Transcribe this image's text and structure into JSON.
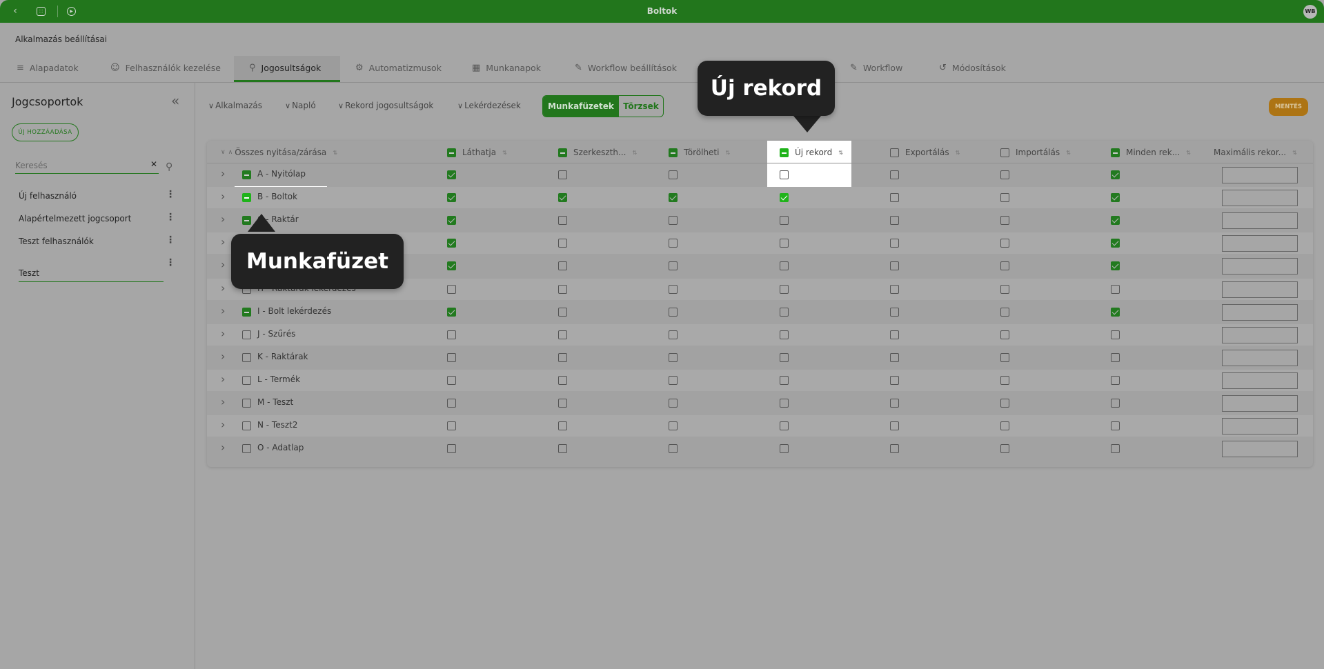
{
  "topbar": {
    "title": "Boltok",
    "avatar": "WB",
    "icons": [
      "back-icon",
      "grid-icon",
      "play-icon"
    ]
  },
  "app_title": "Alkalmazás beállításai",
  "tabs": [
    {
      "label": "Alapadatok",
      "icon": "database-icon"
    },
    {
      "label": "Felhasználók kezelése",
      "icon": "user-icon"
    },
    {
      "label": "Jogosultságok",
      "icon": "key-icon",
      "active": true
    },
    {
      "label": "Automatizmusok",
      "icon": "gear-cycle-icon"
    },
    {
      "label": "Munkanapok",
      "icon": "calendar-icon"
    },
    {
      "label": "Workflow beállítások",
      "icon": "pencil-icon"
    },
    {
      "label": "Workflow",
      "icon": "pencil-icon"
    },
    {
      "label": "Módosítások",
      "icon": "history-icon"
    }
  ],
  "sidebar": {
    "title": "Jogcsoportok",
    "add_button": "ÚJ HOZZÁADÁSA",
    "search_placeholder": "Keresés",
    "items": [
      "Új felhasználó",
      "Alapértelmezett jogcsoport",
      "Teszt felhasználók"
    ],
    "editing_value": "Teszt"
  },
  "filters": [
    "Alkalmazás",
    "Napló",
    "Rekord jogosultságok",
    "Lekérdezések"
  ],
  "toggle": {
    "options": [
      "Munkafüzetek",
      "Törzsek"
    ],
    "selected": "Munkafüzetek"
  },
  "save_button": "MENTÉS",
  "table": {
    "expand_all": "Összes nyitása/zárása",
    "columns": [
      {
        "label": "Láthatja",
        "state": "ind"
      },
      {
        "label": "Szerkeszth...",
        "state": "ind"
      },
      {
        "label": "Törölheti",
        "state": "ind"
      },
      {
        "label": "Új rekord",
        "state": "ind"
      },
      {
        "label": "Exportálás",
        "state": "off"
      },
      {
        "label": "Importálás",
        "state": "off"
      },
      {
        "label": "Minden rek...",
        "state": "ind"
      }
    ],
    "max_column": "Maximális rekor...",
    "rows": [
      {
        "label": "A - Nyitólap",
        "state": "ind",
        "checks": [
          1,
          0,
          0,
          0,
          0,
          0,
          1
        ]
      },
      {
        "label": "B - Boltok",
        "state": "ind",
        "checks": [
          1,
          1,
          1,
          1,
          0,
          0,
          1
        ]
      },
      {
        "label": "C - Raktár",
        "state": "ind",
        "checks": [
          1,
          0,
          0,
          0,
          0,
          0,
          1
        ]
      },
      {
        "label": "",
        "state": "ind",
        "checks": [
          1,
          0,
          0,
          0,
          0,
          0,
          1
        ]
      },
      {
        "label": "",
        "state": "ind",
        "checks": [
          1,
          0,
          0,
          0,
          0,
          0,
          1
        ]
      },
      {
        "label": "H - Raktárak lekérdezés",
        "state": "off",
        "checks": [
          0,
          0,
          0,
          0,
          0,
          0,
          0
        ]
      },
      {
        "label": "I - Bolt lekérdezés",
        "state": "ind",
        "checks": [
          1,
          0,
          0,
          0,
          0,
          0,
          1
        ]
      },
      {
        "label": "J - Szűrés",
        "state": "off",
        "checks": [
          0,
          0,
          0,
          0,
          0,
          0,
          0
        ]
      },
      {
        "label": "K - Raktárak",
        "state": "off",
        "checks": [
          0,
          0,
          0,
          0,
          0,
          0,
          0
        ]
      },
      {
        "label": "L - Termék",
        "state": "off",
        "checks": [
          0,
          0,
          0,
          0,
          0,
          0,
          0
        ]
      },
      {
        "label": "M - Teszt",
        "state": "off",
        "checks": [
          0,
          0,
          0,
          0,
          0,
          0,
          0
        ]
      },
      {
        "label": "N - Teszt2",
        "state": "off",
        "checks": [
          0,
          0,
          0,
          0,
          0,
          0,
          0
        ]
      },
      {
        "label": "O - Adatlap",
        "state": "off",
        "checks": [
          0,
          0,
          0,
          0,
          0,
          0,
          0
        ]
      }
    ]
  },
  "tooltips": {
    "new_record": "Új rekord",
    "workbook": "Munkafüzet"
  },
  "colors": {
    "brand_green": "#22761c",
    "highlight_green": "#1fb31a",
    "save": "#ad7414"
  }
}
